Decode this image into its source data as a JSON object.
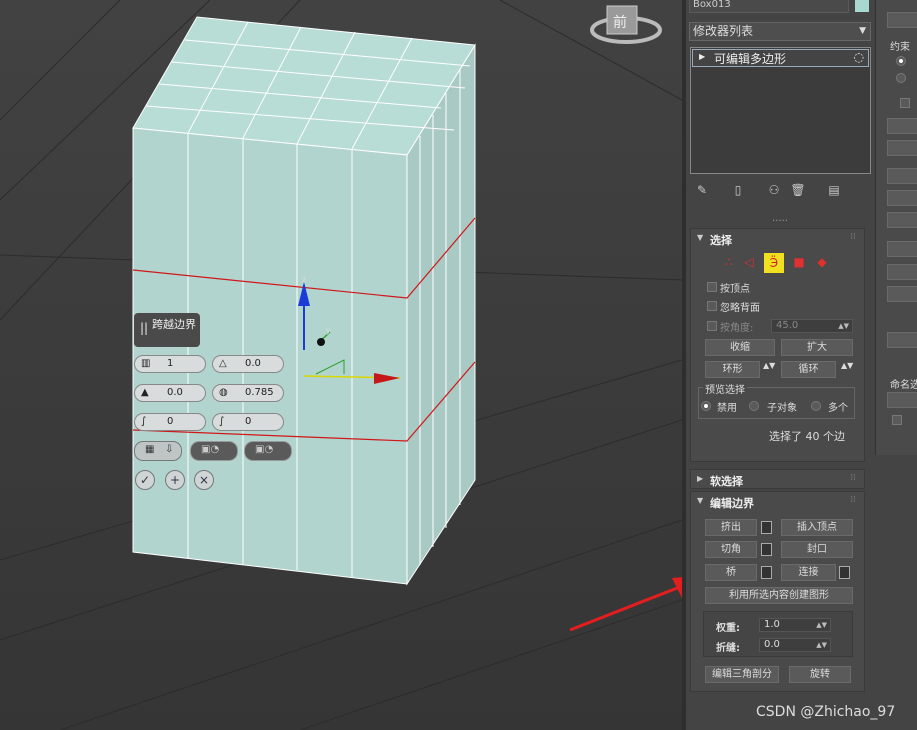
{
  "viewport": {
    "navcube_label": "前"
  },
  "caddy": {
    "title": "跨越边界",
    "fields": [
      "1",
      "0.0",
      "0.0",
      "0.785",
      "0",
      "0"
    ]
  },
  "panel": {
    "object_name": "Box013",
    "modifier_list": "修改器列表",
    "stack_item": "可编辑多边形",
    "selection": {
      "title": "选择",
      "by_vertex": "按顶点",
      "ignore_backfacing": "忽略背面",
      "by_angle": "按角度:",
      "angle_value": "45.0",
      "shrink": "收缩",
      "grow": "扩大",
      "ring": "环形",
      "loop": "循环",
      "preview_selection": "预览选择",
      "disabled": "禁用",
      "subobject": "子对象",
      "multi": "多个",
      "status": "选择了 40 个边"
    },
    "soft_selection": {
      "title": "软选择"
    },
    "edit_edges": {
      "title": "编辑边界",
      "extrude": "挤出",
      "insert_vertex": "插入顶点",
      "chamfer": "切角",
      "cap": "封口",
      "bridge": "桥",
      "connect": "连接",
      "create_shape": "利用所选内容创建图形",
      "weight_label": "权重:",
      "weight_value": "1.0",
      "crease_label": "折缝:",
      "crease_value": "0.0",
      "edit_triangulation": "编辑三角剖分",
      "turn": "旋转"
    }
  },
  "right_column": {
    "constraint": "约束",
    "named": "命名选"
  },
  "watermark": "CSDN @Zhichao_97"
}
